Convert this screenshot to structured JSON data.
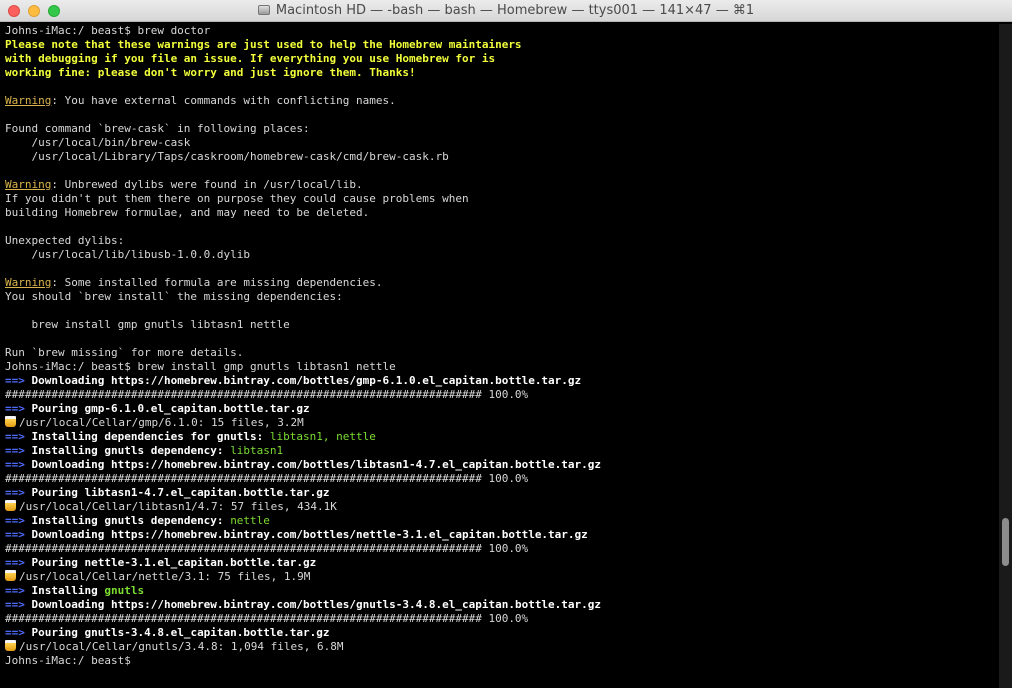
{
  "window": {
    "title": "Macintosh HD — -bash — bash — Homebrew — ttys001 — 141×47 — ⌘1"
  },
  "colors": {
    "note": "#f2ff3a",
    "warning": "#d9b34b",
    "arrow": "#4e6bff",
    "green": "#7bdc32",
    "text": "#d8d8d8"
  },
  "terminal": {
    "lines": [
      [
        {
          "t": "Johns-iMac:/ beast$ brew doctor",
          "c": "plain"
        }
      ],
      [
        {
          "t": "Please note that these warnings are just used to help the Homebrew maintainers",
          "c": "note"
        }
      ],
      [
        {
          "t": "with debugging if you file an issue. If everything you use Homebrew for is",
          "c": "note"
        }
      ],
      [
        {
          "t": "working fine: please don't worry and just ignore them. Thanks!",
          "c": "note"
        }
      ],
      [],
      [
        {
          "t": "Warning",
          "c": "warn"
        },
        {
          "t": ": You have external commands with conflicting names.",
          "c": "plain"
        }
      ],
      [],
      [
        {
          "t": "Found command `brew-cask` in following places:",
          "c": "plain"
        }
      ],
      [
        {
          "t": "    /usr/local/bin/brew-cask",
          "c": "plain"
        }
      ],
      [
        {
          "t": "    /usr/local/Library/Taps/caskroom/homebrew-cask/cmd/brew-cask.rb",
          "c": "plain"
        }
      ],
      [],
      [
        {
          "t": "Warning",
          "c": "warn"
        },
        {
          "t": ": Unbrewed dylibs were found in /usr/local/lib.",
          "c": "plain"
        }
      ],
      [
        {
          "t": "If you didn't put them there on purpose they could cause problems when",
          "c": "plain"
        }
      ],
      [
        {
          "t": "building Homebrew formulae, and may need to be deleted.",
          "c": "plain"
        }
      ],
      [],
      [
        {
          "t": "Unexpected dylibs:",
          "c": "plain"
        }
      ],
      [
        {
          "t": "    /usr/local/lib/libusb-1.0.0.dylib",
          "c": "plain"
        }
      ],
      [],
      [
        {
          "t": "Warning",
          "c": "warn"
        },
        {
          "t": ": Some installed formula are missing dependencies.",
          "c": "plain"
        }
      ],
      [
        {
          "t": "You should `brew install` the missing dependencies:",
          "c": "plain"
        }
      ],
      [],
      [
        {
          "t": "    brew install gmp gnutls libtasn1 nettle",
          "c": "plain"
        }
      ],
      [],
      [
        {
          "t": "Run `brew missing` for more details.",
          "c": "plain"
        }
      ],
      [
        {
          "t": "Johns-iMac:/ beast$ brew install gmp gnutls libtasn1 nettle",
          "c": "plain"
        }
      ],
      [
        {
          "t": "==> ",
          "c": "arrow"
        },
        {
          "t": "Downloading https://homebrew.bintray.com/bottles/gmp-6.1.0.el_capitan.bottle.tar.gz",
          "c": "bold"
        }
      ],
      [
        {
          "t": "######################################################################## 100.0%",
          "c": "plain"
        }
      ],
      [
        {
          "t": "==> ",
          "c": "arrow"
        },
        {
          "t": "Pouring gmp-6.1.0.el_capitan.bottle.tar.gz",
          "c": "bold"
        }
      ],
      [
        {
          "beer": true
        },
        {
          "t": "/usr/local/Cellar/gmp/6.1.0: 15 files, 3.2M",
          "c": "plain"
        }
      ],
      [
        {
          "t": "==> ",
          "c": "arrow"
        },
        {
          "t": "Installing dependencies for gnutls: ",
          "c": "bold"
        },
        {
          "t": "libtasn1, nettle",
          "c": "green"
        }
      ],
      [
        {
          "t": "==> ",
          "c": "arrow"
        },
        {
          "t": "Installing gnutls dependency: ",
          "c": "bold"
        },
        {
          "t": "libtasn1",
          "c": "green"
        }
      ],
      [
        {
          "t": "==> ",
          "c": "arrow"
        },
        {
          "t": "Downloading https://homebrew.bintray.com/bottles/libtasn1-4.7.el_capitan.bottle.tar.gz",
          "c": "bold"
        }
      ],
      [
        {
          "t": "######################################################################## 100.0%",
          "c": "plain"
        }
      ],
      [
        {
          "t": "==> ",
          "c": "arrow"
        },
        {
          "t": "Pouring libtasn1-4.7.el_capitan.bottle.tar.gz",
          "c": "bold"
        }
      ],
      [
        {
          "beer": true
        },
        {
          "t": "/usr/local/Cellar/libtasn1/4.7: 57 files, 434.1K",
          "c": "plain"
        }
      ],
      [
        {
          "t": "==> ",
          "c": "arrow"
        },
        {
          "t": "Installing gnutls dependency: ",
          "c": "bold"
        },
        {
          "t": "nettle",
          "c": "green"
        }
      ],
      [
        {
          "t": "==> ",
          "c": "arrow"
        },
        {
          "t": "Downloading https://homebrew.bintray.com/bottles/nettle-3.1.el_capitan.bottle.tar.gz",
          "c": "bold"
        }
      ],
      [
        {
          "t": "######################################################################## 100.0%",
          "c": "plain"
        }
      ],
      [
        {
          "t": "==> ",
          "c": "arrow"
        },
        {
          "t": "Pouring nettle-3.1.el_capitan.bottle.tar.gz",
          "c": "bold"
        }
      ],
      [
        {
          "beer": true
        },
        {
          "t": "/usr/local/Cellar/nettle/3.1: 75 files, 1.9M",
          "c": "plain"
        }
      ],
      [
        {
          "t": "==> ",
          "c": "arrow"
        },
        {
          "t": "Installing ",
          "c": "bold"
        },
        {
          "t": "gnutls",
          "c": "greenb"
        }
      ],
      [
        {
          "t": "==> ",
          "c": "arrow"
        },
        {
          "t": "Downloading https://homebrew.bintray.com/bottles/gnutls-3.4.8.el_capitan.bottle.tar.gz",
          "c": "bold"
        }
      ],
      [
        {
          "t": "######################################################################## 100.0%",
          "c": "plain"
        }
      ],
      [
        {
          "t": "==> ",
          "c": "arrow"
        },
        {
          "t": "Pouring gnutls-3.4.8.el_capitan.bottle.tar.gz",
          "c": "bold"
        }
      ],
      [
        {
          "beer": true
        },
        {
          "t": "/usr/local/Cellar/gnutls/3.4.8: 1,094 files, 6.8M",
          "c": "plain"
        }
      ],
      [
        {
          "t": "Johns-iMac:/ beast$ ",
          "c": "plain"
        }
      ]
    ]
  }
}
